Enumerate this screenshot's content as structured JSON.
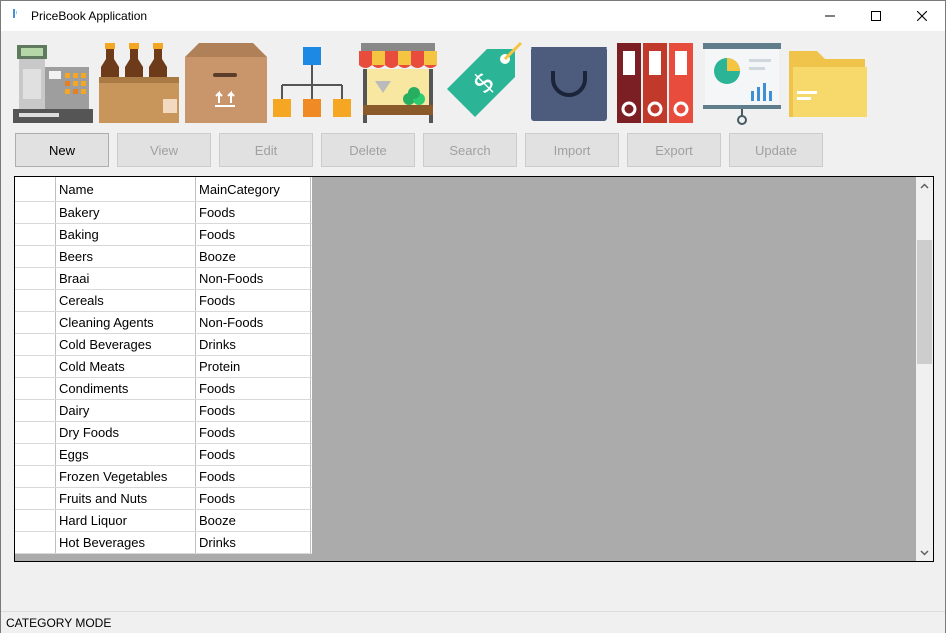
{
  "window": {
    "title": "PriceBook Application"
  },
  "toolbar": {
    "icons": [
      "cash-register-icon",
      "beer-bottles-icon",
      "shipping-box-icon",
      "hierarchy-icon",
      "market-stall-icon",
      "price-tag-icon",
      "shopping-bag-icon",
      "binders-icon",
      "presentation-board-icon",
      "folder-icon"
    ]
  },
  "buttons": {
    "new": "New",
    "view": "View",
    "edit": "Edit",
    "delete": "Delete",
    "search": "Search",
    "import": "Import",
    "export": "Export",
    "update": "Update"
  },
  "grid": {
    "columns": {
      "name": "Name",
      "main_category": "MainCategory"
    },
    "rows": [
      {
        "name": "Bakery",
        "main_category": "Foods"
      },
      {
        "name": "Baking",
        "main_category": "Foods"
      },
      {
        "name": "Beers",
        "main_category": "Booze"
      },
      {
        "name": "Braai",
        "main_category": "Non-Foods"
      },
      {
        "name": "Cereals",
        "main_category": "Foods"
      },
      {
        "name": "Cleaning Agents",
        "main_category": "Non-Foods"
      },
      {
        "name": "Cold Beverages",
        "main_category": "Drinks"
      },
      {
        "name": "Cold Meats",
        "main_category": "Protein"
      },
      {
        "name": "Condiments",
        "main_category": "Foods"
      },
      {
        "name": "Dairy",
        "main_category": "Foods"
      },
      {
        "name": "Dry Foods",
        "main_category": "Foods"
      },
      {
        "name": "Eggs",
        "main_category": "Foods"
      },
      {
        "name": "Frozen Vegetables",
        "main_category": "Foods"
      },
      {
        "name": "Fruits and Nuts",
        "main_category": "Foods"
      },
      {
        "name": "Hard Liquor",
        "main_category": "Booze"
      },
      {
        "name": "Hot Beverages",
        "main_category": "Drinks"
      }
    ]
  },
  "status": {
    "mode": "CATEGORY MODE"
  }
}
